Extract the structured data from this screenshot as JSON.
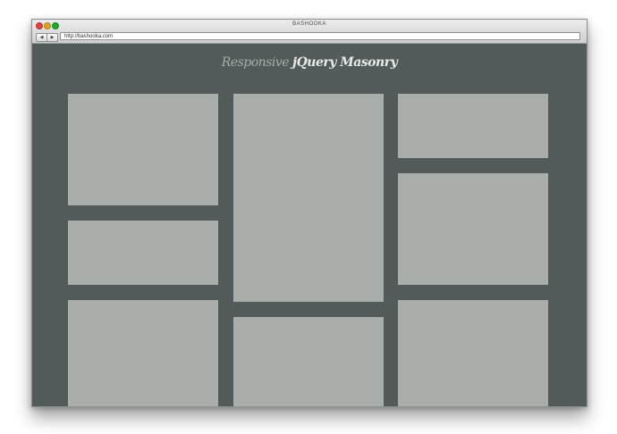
{
  "window": {
    "title": "BASHOOKA",
    "url": "http://bashooka.com",
    "back_icon": "◀",
    "forward_icon": "▶"
  },
  "page": {
    "heading_light": "Responsive ",
    "heading_bold": "jQuery Masonry",
    "background_color": "#525b59",
    "tile_color": "#a9aeab"
  }
}
